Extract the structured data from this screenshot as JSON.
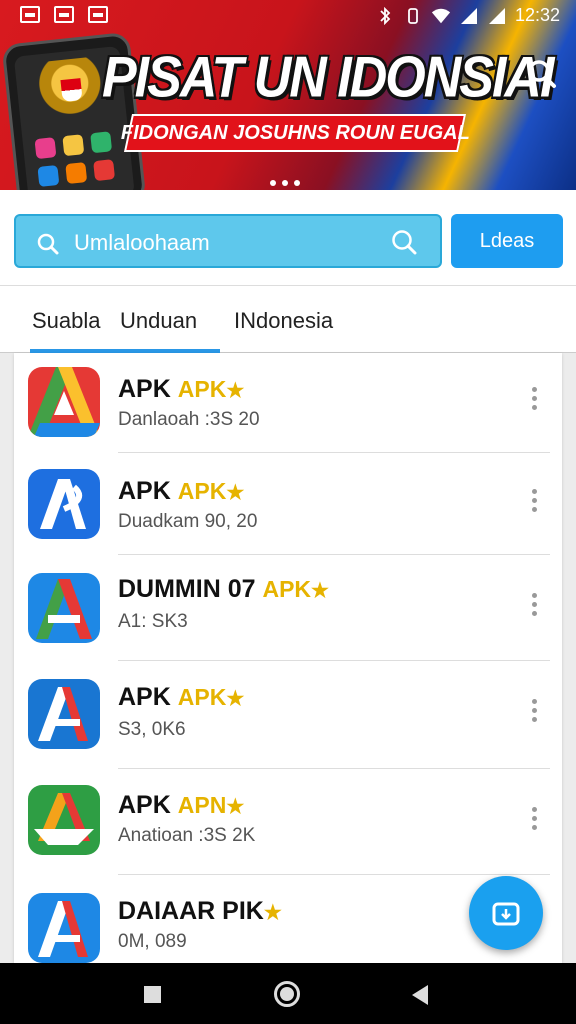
{
  "status_bar": {
    "time": "12:32"
  },
  "banner": {
    "title": "PISAT UN IDONSIAI",
    "subtitle": "FIDONGAN JOSUHNS ROUN EUGAL"
  },
  "search": {
    "value": "Umlaloohaam",
    "button_label": "Ldeas"
  },
  "tabs": [
    {
      "label": "Suabla",
      "active": true
    },
    {
      "label": "Unduan"
    },
    {
      "label": "INdonesia"
    }
  ],
  "apps": [
    {
      "name": "APK",
      "badge": "APK",
      "sub": "Danlaoah :3S 20",
      "icon": "google-drive-style-icon"
    },
    {
      "name": "APK",
      "badge": "APK",
      "sub": "Duadkam 90, 20",
      "icon": "blue-a-logo-icon"
    },
    {
      "name": "DUMMIN 07",
      "badge": "APK",
      "sub": "A1: SK3",
      "icon": "tricolor-a-logo-icon"
    },
    {
      "name": "APK",
      "badge": "APK",
      "sub": "S3, 0K6",
      "icon": "blue-red-a-logo-icon"
    },
    {
      "name": "APK",
      "badge": "APN",
      "sub": "Anatioan :3S 2K",
      "icon": "green-a-logo-icon"
    },
    {
      "name": "DAIAAR PIK",
      "badge": "",
      "sub": "0M, 089",
      "icon": "blue-a-logo-icon"
    }
  ],
  "colors": {
    "accent": "#1e9df0",
    "banner_red": "#c8141b",
    "badge_gold": "#e6b300"
  }
}
